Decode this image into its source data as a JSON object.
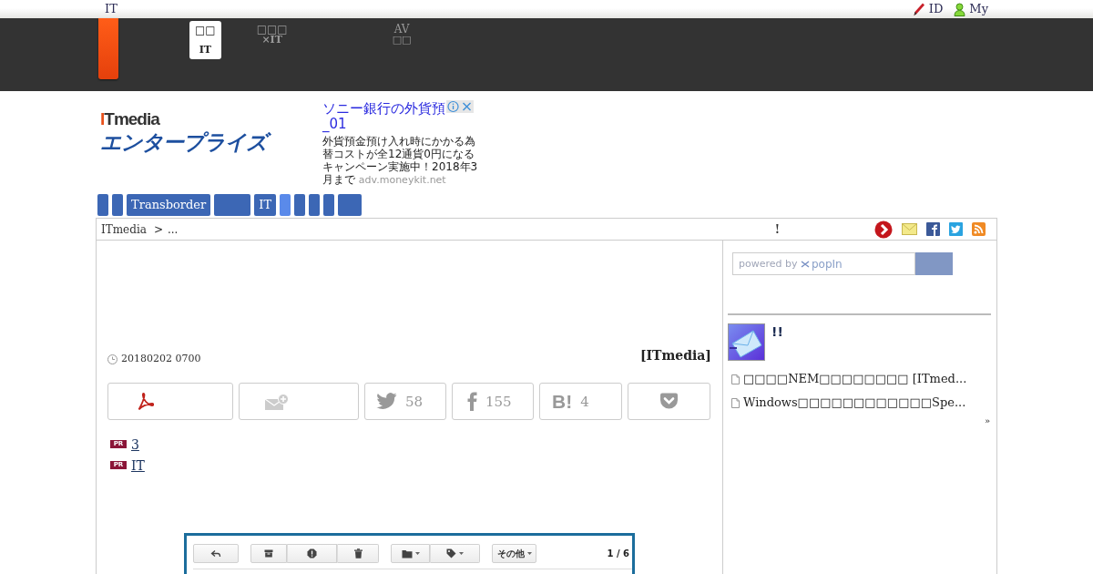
{
  "top_bar": {
    "site_label": "IT",
    "links": [
      {
        "kind": "edit",
        "label": "ID"
      },
      {
        "kind": "user",
        "label": "My"
      }
    ]
  },
  "channel_tabs": [
    {
      "lines": [
        "□□",
        "IT"
      ],
      "selected": true
    },
    {
      "lines": [
        "□□□",
        "×IT"
      ],
      "selected": false
    },
    {
      "lines": [
        "AV",
        "□□"
      ],
      "selected": false
    }
  ],
  "header": {
    "logo": {
      "brand": "ITmedia",
      "subtitle": "エンタープライズ"
    },
    "ad": {
      "title": "ソニー銀行の外貨預",
      "title_end": "_01",
      "body": "外貨預金預け入れ時にかかる為替コストが全12通貨0円になるキャンペーン実施中！2018年3月まで",
      "domain": "adv.moneykit.net"
    }
  },
  "section_nav": [
    {
      "selected": false
    },
    {
      "selected": false
    },
    {
      "label": "Transborder",
      "selected": false
    },
    {
      "selected": false
    },
    {
      "label": "IT",
      "selected": false
    },
    {
      "selected": true
    },
    {
      "selected": false
    },
    {
      "selected": false
    },
    {
      "selected": false
    },
    {
      "selected": false
    }
  ],
  "breadcrumb": {
    "items": [
      "ITmedia",
      "..."
    ],
    "separator": ">",
    "notice": "!",
    "icons": [
      {
        "kind": "next"
      },
      {
        "kind": "mail"
      },
      {
        "kind": "facebook"
      },
      {
        "kind": "twitter"
      },
      {
        "kind": "rss"
      }
    ]
  },
  "article": {
    "date": "20180202 0700",
    "source": "[ITmedia]",
    "share": [
      {
        "kind": "pdf"
      },
      {
        "kind": "mail"
      },
      {
        "kind": "twitter",
        "count": "58"
      },
      {
        "kind": "facebook",
        "count": "155"
      },
      {
        "kind": "hatena",
        "glyph": "B!",
        "count": "4"
      },
      {
        "kind": "pocket"
      }
    ],
    "pr_links": [
      {
        "badge": "PR",
        "text": "3"
      },
      {
        "badge": "PR",
        "text": "IT"
      }
    ],
    "figure": {
      "toolbar": [
        {
          "buttons": [
            {
              "kind": "reply",
              "dropdown": false
            }
          ]
        },
        {
          "buttons": [
            {
              "kind": "archive",
              "dropdown": false
            },
            {
              "kind": "spam",
              "dropdown": false
            },
            {
              "kind": "delete",
              "dropdown": false
            }
          ]
        },
        {
          "buttons": [
            {
              "kind": "folder",
              "dropdown": true
            },
            {
              "kind": "tag",
              "dropdown": true
            }
          ]
        },
        {
          "buttons": [
            {
              "kind": "text",
              "label": "その他",
              "dropdown": true
            }
          ]
        }
      ],
      "page_count": "1 / 6"
    }
  },
  "sidebar": {
    "search": {
      "placeholder": "powered by",
      "brand": "popIn"
    },
    "ranking": {
      "title": "!!",
      "items": [
        "□□□□NEM□□□□□□□□ [ITmed...",
        "Windows□□□□□□□□□□□□Spe..."
      ],
      "more": "»"
    }
  }
}
